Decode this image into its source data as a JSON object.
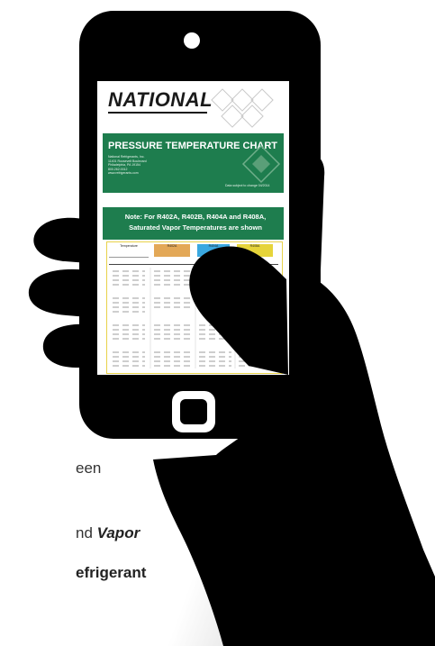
{
  "chart": {
    "brand": "NATIONAL",
    "title": "PRESSURE TEMPERATURE CHART",
    "company_lines": [
      "National Refrigerants, Inc.",
      "11401 Roosevelt Boulevard",
      "Philadelphia, PA 19154",
      "800.262.0012",
      "www.refrigerants.com"
    ],
    "disclaimer": "Data subject to change 04/2014",
    "note_line1": "Note: For R402A, R402B, R404A and R408A,",
    "note_line2": "Saturated Vapor Temperatures are shown",
    "column_headers": [
      "Temperature",
      "R402A",
      "R404A",
      "R408A"
    ],
    "colors": {
      "green": "#1e7d4e",
      "orange": "#e3a857",
      "blue": "#3aa8e0",
      "yellow": "#e6d43a"
    }
  },
  "caption": {
    "frag1": "een",
    "frag2_prefix": "nd ",
    "frag2_italic": "Vapor",
    "frag3": "efrigerant"
  },
  "icons": [
    "phone-camera-icon",
    "home-button-icon",
    "hand-icon"
  ]
}
